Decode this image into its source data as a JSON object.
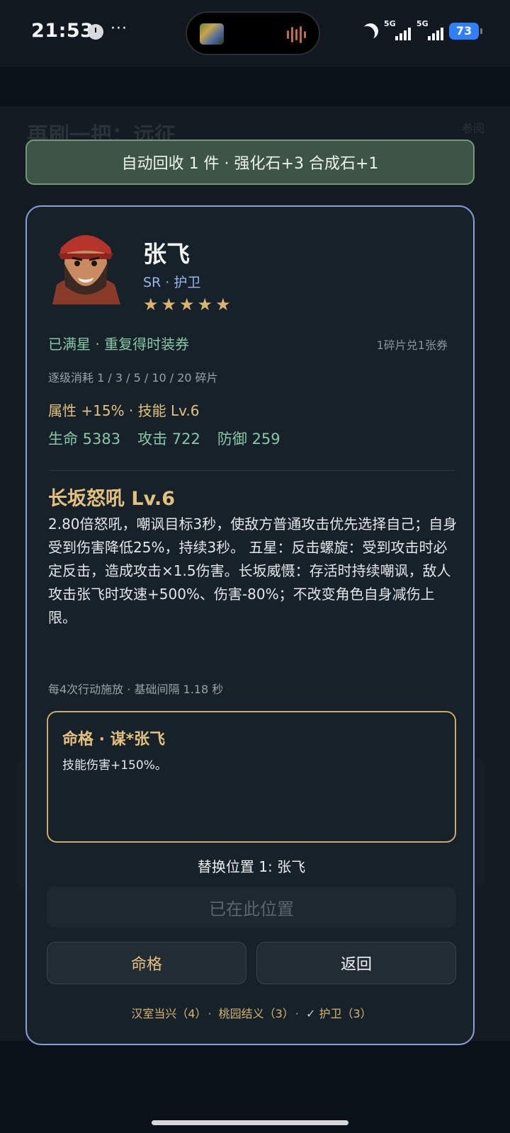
{
  "status_bar": {
    "time": "21:53",
    "more": "···",
    "network1": "5G",
    "network2": "5G",
    "battery": "73"
  },
  "background": {
    "title": "再刷一把：远征",
    "top_right": "参阅",
    "left_sub": "",
    "right_sub": "",
    "bottom_left": "",
    "bottom_right": ""
  },
  "toast": {
    "text": "自动回收 1 件 · 强化石+3 合成石+1"
  },
  "hero": {
    "name": "张飞",
    "rarity_role": "SR · 护卫",
    "stars": [
      "★",
      "★",
      "★",
      "★",
      "★"
    ],
    "max_star_text": "已满星 · 重复得时装券",
    "exchange_text": "1碎片兑1张券",
    "cost_text": "逐级消耗 1 / 3 / 5 / 10 / 20 碎片",
    "attr_text": "属性 +15% · 技能 Lv.6",
    "stats": {
      "hp": "生命 5383",
      "atk": "攻击 722",
      "def": "防御 259"
    },
    "skill_title": "长坂怒吼 Lv.6",
    "skill_desc": "2.80倍怒吼，嘲讽目标3秒，使敌方普通攻击优先选择自己；自身受到伤害降低25%，持续3秒。 五星：反击螺旋：受到攻击时必定反击，造成攻击×1.5伤害。长坂威慑：存活时持续嘲讽，敌人攻击张飞时攻速+500%、伤害-80%；不改变角色自身减伤上限。",
    "cast_info": "每4次行动施放 · 基础间隔 1.18 秒"
  },
  "destiny": {
    "title": "命格 · 谋*张飞",
    "desc": "技能伤害+150%。"
  },
  "replace_position": "替换位置 1:  张飞",
  "buttons": {
    "in_place": "已在此位置",
    "destiny": "命格",
    "back": "返回"
  },
  "bonds": {
    "b1": "汉室当兴（4）",
    "b2": "桃园结义（3）",
    "b3_check": "✓",
    "b3": "护卫（3）",
    "sep": "·"
  },
  "colors": {
    "accent_gold": "#e3c07e",
    "accent_green": "#86c8a6",
    "accent_blue": "#9cb4f0",
    "modal_border": "#8d9ed6",
    "toast_bg": "#3d5446"
  },
  "icons": [
    "clock-icon",
    "moon-icon",
    "signal-icon",
    "battery-icon",
    "star-icon",
    "check-icon"
  ]
}
